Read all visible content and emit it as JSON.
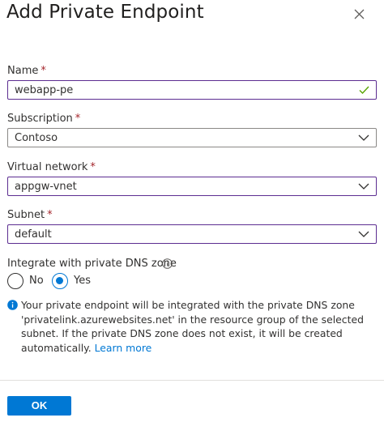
{
  "dialog": {
    "title": "Add Private Endpoint",
    "close_icon": "close-icon"
  },
  "form": {
    "name": {
      "label": "Name",
      "required_mark": "*",
      "value": "webapp-pe",
      "icon": "checkmark-icon"
    },
    "subscription": {
      "label": "Subscription",
      "required_mark": "*",
      "value": "Contoso",
      "icon": "chevron-down-icon"
    },
    "virtual_network": {
      "label": "Virtual network",
      "required_mark": "*",
      "value": "appgw-vnet",
      "icon": "chevron-down-icon"
    },
    "subnet": {
      "label": "Subnet",
      "required_mark": "*",
      "value": "default",
      "icon": "chevron-down-icon"
    },
    "dns": {
      "label": "Integrate with private DNS zone",
      "info_icon": "info-icon",
      "options": [
        "No",
        "Yes"
      ],
      "selected": "Yes"
    }
  },
  "info_note": {
    "icon": "info-filled-icon",
    "text": "Your private endpoint will be integrated with the private DNS zone 'privatelink.azurewebsites.net' in the resource group of the selected subnet. If the private DNS zone does not exist, it will be created automatically.",
    "link_text": "Learn more"
  },
  "footer": {
    "ok_label": "OK"
  },
  "colors": {
    "accent": "#0078d4",
    "focus_border": "#5c2d91",
    "required": "#a4262c",
    "valid": "#57a300"
  }
}
